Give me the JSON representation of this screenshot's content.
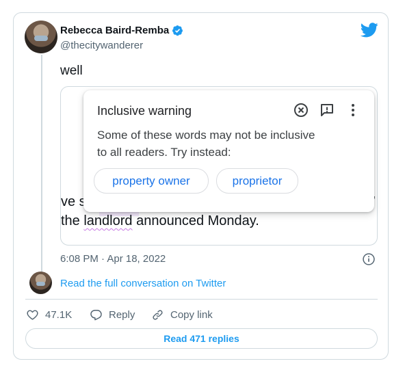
{
  "tweet": {
    "author_name": "Rebecca Baird-Remba",
    "author_handle": "@thecitywanderer",
    "text": "well",
    "timestamp": "6:08 PM · Apr 18, 2022",
    "read_conversation": "Read the full conversation on Twitter"
  },
  "embedded_doc": {
    "line1_start": "ve s",
    "line1_end": "’",
    "line2_before": "the ",
    "flagged_word": "landlord",
    "line2_after": " announced Monday."
  },
  "popup": {
    "title": "Inclusive warning",
    "body": "Some of these words may not be inclusive to all readers. Try instead:",
    "suggestions": [
      "property owner",
      "proprietor"
    ],
    "icons": [
      "dismiss-icon",
      "feedback-icon",
      "more-options-icon"
    ]
  },
  "actions": {
    "likes": "47.1K",
    "reply": "Reply",
    "copy_link": "Copy link",
    "read_replies": "Read 471 replies"
  },
  "colors": {
    "twitter_blue": "#1d9bf0",
    "suggestion_blue": "#1a73e8",
    "flag_purple": "#c77be3"
  }
}
